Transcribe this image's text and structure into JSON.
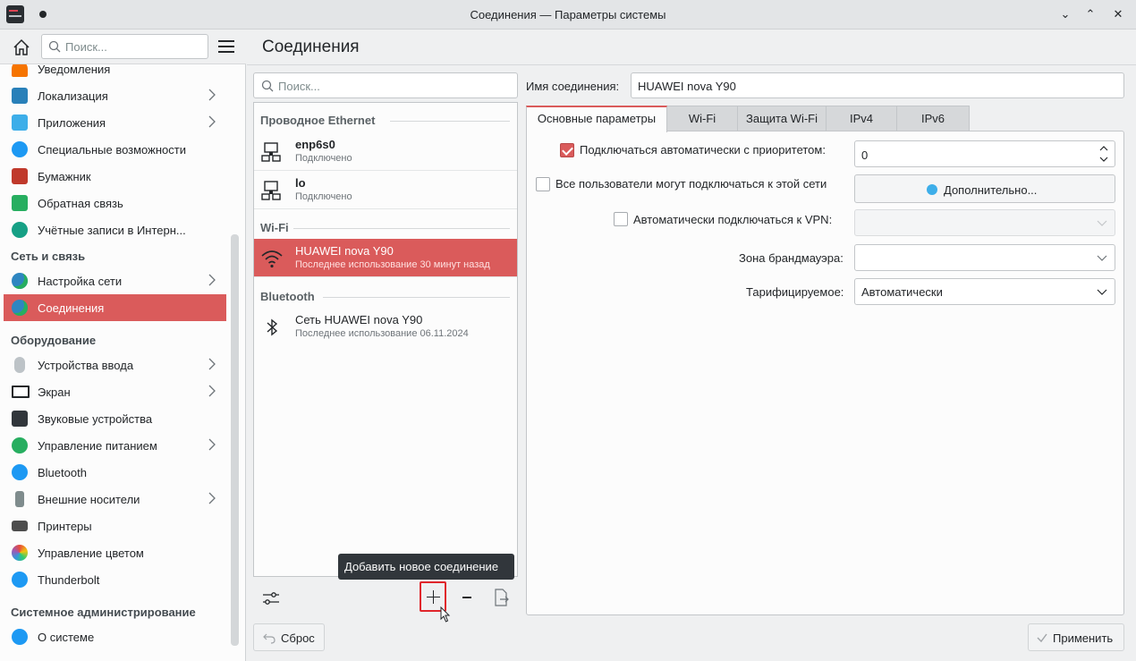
{
  "window": {
    "title": "Соединения — Параметры системы",
    "buttons": {
      "minimize": "⌄",
      "maximize": "⌃",
      "close": "✕"
    }
  },
  "sidebar": {
    "search_placeholder": "Поиск...",
    "items": [
      {
        "label": "Уведомления",
        "icon": "bell-icon",
        "color": "#f67400",
        "arrow": false
      },
      {
        "label": "Локализация",
        "icon": "flag-icon",
        "color": "#2980b9",
        "arrow": true
      },
      {
        "label": "Приложения",
        "icon": "apps-icon",
        "color": "#3daee9",
        "arrow": true
      },
      {
        "label": "Специальные возможности",
        "icon": "accessibility-icon",
        "color": "#1d99f3",
        "arrow": false
      },
      {
        "label": "Бумажник",
        "icon": "wallet-icon",
        "color": "#c0392b",
        "arrow": false
      },
      {
        "label": "Обратная связь",
        "icon": "feedback-icon",
        "color": "#27ae60",
        "arrow": false
      },
      {
        "label": "Учётные записи в Интерн...",
        "icon": "online-accounts-icon",
        "color": "#16a085",
        "arrow": false
      }
    ],
    "section_network": "Сеть и связь",
    "network_items": [
      {
        "label": "Настройка сети",
        "icon": "globe-icon",
        "arrow": true
      },
      {
        "label": "Соединения",
        "icon": "globe-icon",
        "arrow": false,
        "selected": true
      }
    ],
    "section_hardware": "Оборудование",
    "hardware_items": [
      {
        "label": "Устройства ввода",
        "icon": "mouse-icon",
        "arrow": true
      },
      {
        "label": "Экран",
        "icon": "monitor-icon",
        "arrow": true
      },
      {
        "label": "Звуковые устройства",
        "icon": "speaker-icon",
        "arrow": false
      },
      {
        "label": "Управление питанием",
        "icon": "power-icon",
        "arrow": true
      },
      {
        "label": "Bluetooth",
        "icon": "bluetooth-icon",
        "arrow": false
      },
      {
        "label": "Внешние носители",
        "icon": "usb-icon",
        "arrow": true
      },
      {
        "label": "Принтеры",
        "icon": "printer-icon",
        "arrow": false
      },
      {
        "label": "Управление цветом",
        "icon": "color-icon",
        "arrow": false
      },
      {
        "label": "Thunderbolt",
        "icon": "thunderbolt-icon",
        "arrow": false
      }
    ],
    "section_admin": "Системное администрирование",
    "admin_items": [
      {
        "label": "О системе",
        "icon": "info-icon",
        "arrow": false
      }
    ]
  },
  "header": {
    "title": "Соединения"
  },
  "connections": {
    "search_placeholder": "Поиск...",
    "section_ethernet": "Проводное Ethernet",
    "section_wifi": "Wi-Fi",
    "section_bluetooth": "Bluetooth",
    "items": [
      {
        "name": "enp6s0",
        "status": "Подключено"
      },
      {
        "name": "lo",
        "status": "Подключено"
      },
      {
        "name": "HUAWEI nova Y90",
        "status": "Последнее использование 30 минут назад"
      },
      {
        "name": "Сеть HUAWEI nova Y90",
        "status": "Последнее использование 06.11.2024"
      }
    ],
    "tooltip": "Добавить новое соединение",
    "reset_label": "Сброс",
    "apply_label": "Применить"
  },
  "details": {
    "name_label": "Имя соединения:",
    "name_value": "HUAWEI nova Y90",
    "tabs": [
      "Основные параметры",
      "Wi-Fi",
      "Защита Wi-Fi",
      "IPv4",
      "IPv6"
    ],
    "auto_connect_label": "Подключаться автоматически с приоритетом:",
    "priority_value": "0",
    "all_users_label": "Все пользователи могут подключаться к этой сети",
    "advanced_label": "Дополнительно...",
    "vpn_label": "Автоматически подключаться к VPN:",
    "firewall_label": "Зона брандмауэра:",
    "metered_label": "Тарифицируемое:",
    "metered_value": "Автоматически"
  },
  "colors": {
    "accent": "#da5b5b",
    "background": "#eff0f1"
  }
}
